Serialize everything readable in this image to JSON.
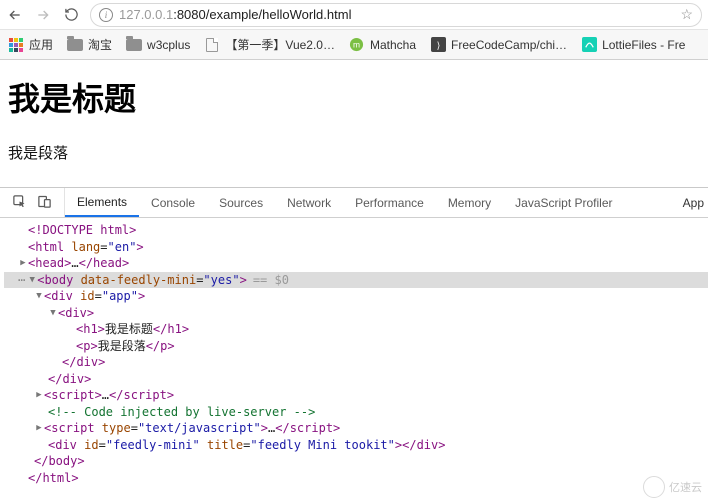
{
  "nav": {
    "url_dim_prefix": "127.0.0.1",
    "url_rest": ":8080/example/helloWorld.html"
  },
  "bookmarks": {
    "apps": "应用",
    "taobao": "淘宝",
    "w3cplus": "w3cplus",
    "vue": "【第一季】Vue2.0…",
    "matcha": "Mathcha",
    "fcc": "FreeCodeCamp/chi…",
    "lottie": "LottieFiles - Fre"
  },
  "page": {
    "heading": "我是标题",
    "paragraph": "我是段落"
  },
  "devtools": {
    "tabs": {
      "elements": "Elements",
      "console": "Console",
      "sources": "Sources",
      "network": "Network",
      "performance": "Performance",
      "memory": "Memory",
      "jsprofiler": "JavaScript Profiler",
      "app": "App"
    },
    "dom": {
      "doctype": "<!DOCTYPE html>",
      "html_open_1": "<",
      "html_open_2": "html",
      "html_lang_attr": " lang",
      "eq": "=",
      "q": "\"",
      "en": "en",
      "gt": ">",
      "head_open": "<head>",
      "head_ell": "…",
      "head_close": "</head>",
      "body_open": "<body",
      "body_attr": " data-feedly-mini",
      "yes": "yes",
      "eq_dollar": "== $0",
      "div_app_open": "<div",
      "id_attr": " id",
      "app": "app",
      "div_open": "<div>",
      "h1_open": "<h1>",
      "h1_text": "我是标题",
      "h1_close": "</h1>",
      "p_open": "<p>",
      "p_text": "我是段落",
      "p_close": "</p>",
      "div_close": "</div>",
      "script_open": "<script>",
      "script_ell": "…",
      "script_close_s": "<",
      "script_close_t": "/script>",
      "comment": "<!-- Code injected by live-server -->",
      "script2_open": "<script",
      "type_attr": " type",
      "type_val": "text/javascript",
      "feedly_div_open": "<div",
      "feedly_id": "feedly-mini",
      "title_attr": " title",
      "title_val": "feedly Mini tookit",
      "feedly_div_close": "</div>",
      "body_close": "</body>",
      "html_close": "</html>"
    }
  },
  "watermark": "亿速云"
}
